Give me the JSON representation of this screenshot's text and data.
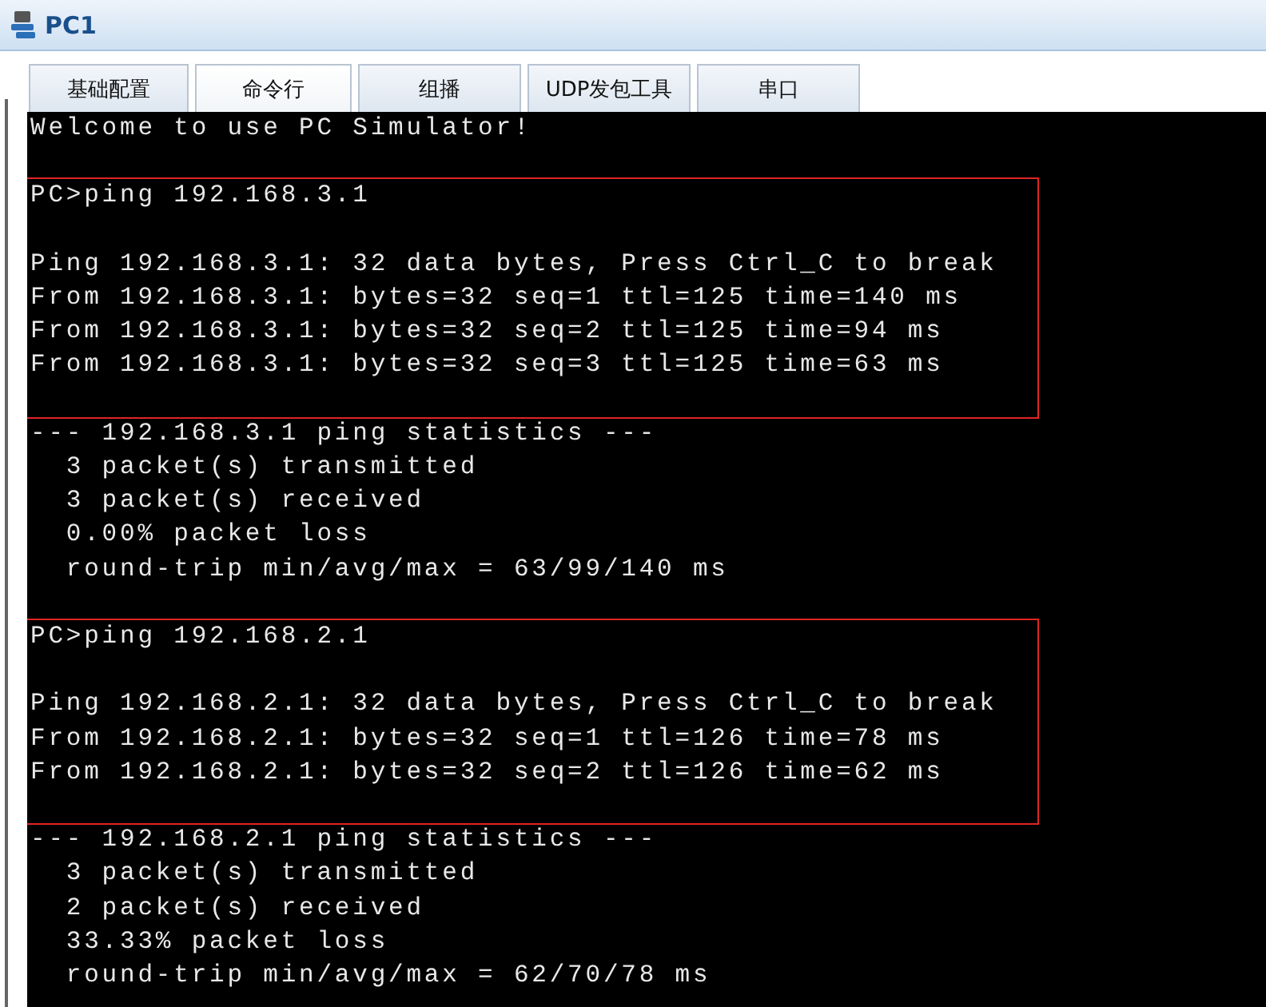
{
  "window": {
    "title": "PC1"
  },
  "tabs": [
    {
      "label": "基础配置",
      "selected": false
    },
    {
      "label": "命令行",
      "selected": true
    },
    {
      "label": "组播",
      "selected": false
    },
    {
      "label": "UDP发包工具",
      "selected": false
    },
    {
      "label": "串口",
      "selected": false
    }
  ],
  "terminal": {
    "blocks": [
      {
        "highlighted": false,
        "paragraphs": [
          [
            "Welcome to use PC Simulator!"
          ]
        ]
      },
      {
        "highlighted": true,
        "paragraphs": [
          [
            "PC>ping 192.168.3.1"
          ],
          [
            "Ping 192.168.3.1: 32 data bytes, Press Ctrl_C to break",
            "From 192.168.3.1: bytes=32 seq=1 ttl=125 time=140 ms",
            "From 192.168.3.1: bytes=32 seq=2 ttl=125 time=94 ms",
            "From 192.168.3.1: bytes=32 seq=3 ttl=125 time=63 ms"
          ]
        ]
      },
      {
        "highlighted": false,
        "paragraphs": [
          [
            "--- 192.168.3.1 ping statistics ---",
            "  3 packet(s) transmitted",
            "  3 packet(s) received",
            "  0.00% packet loss",
            "  round-trip min/avg/max = 63/99/140 ms"
          ]
        ]
      },
      {
        "highlighted": true,
        "paragraphs": [
          [
            "PC>ping 192.168.2.1"
          ],
          [
            "Ping 192.168.2.1: 32 data bytes, Press Ctrl_C to break",
            "From 192.168.2.1: bytes=32 seq=1 ttl=126 time=78 ms",
            "From 192.168.2.1: bytes=32 seq=2 ttl=126 time=62 ms"
          ]
        ]
      },
      {
        "highlighted": false,
        "paragraphs": [
          [
            "--- 192.168.2.1 ping statistics ---",
            "  3 packet(s) transmitted",
            "  2 packet(s) received",
            "  33.33% packet loss",
            "  round-trip min/avg/max = 62/70/78 ms"
          ]
        ]
      }
    ]
  }
}
